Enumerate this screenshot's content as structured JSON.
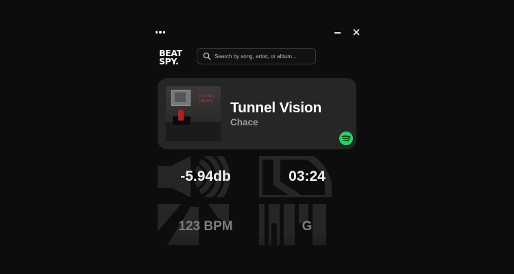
{
  "window": {
    "menu_icon": "ellipsis-icon",
    "minimize_icon": "minimize-icon",
    "close_icon": "close-icon"
  },
  "logo": {
    "line1": "BEAT",
    "line2": "SPY."
  },
  "search": {
    "placeholder": "Search by song, artist, or album...",
    "value": ""
  },
  "now_playing": {
    "title": "Tunnel Vision",
    "artist": "Chace",
    "album_art_text": "TUNNEL VISION",
    "source_icon": "spotify-icon",
    "source_color": "#1ed760"
  },
  "stats": {
    "loudness": {
      "value": "-5.94db",
      "icon": "speaker-icon"
    },
    "duration": {
      "value": "03:24",
      "icon": "clock-icon"
    },
    "tempo": {
      "value": "123 BPM",
      "icon": "waveform-icon"
    },
    "key": {
      "value": "G",
      "icon": "piano-keys-icon"
    }
  },
  "colors": {
    "background": "#0d0d0d",
    "card": "#262626",
    "stat_icon": "#262626",
    "secondary_text": "#9c9c9c"
  }
}
